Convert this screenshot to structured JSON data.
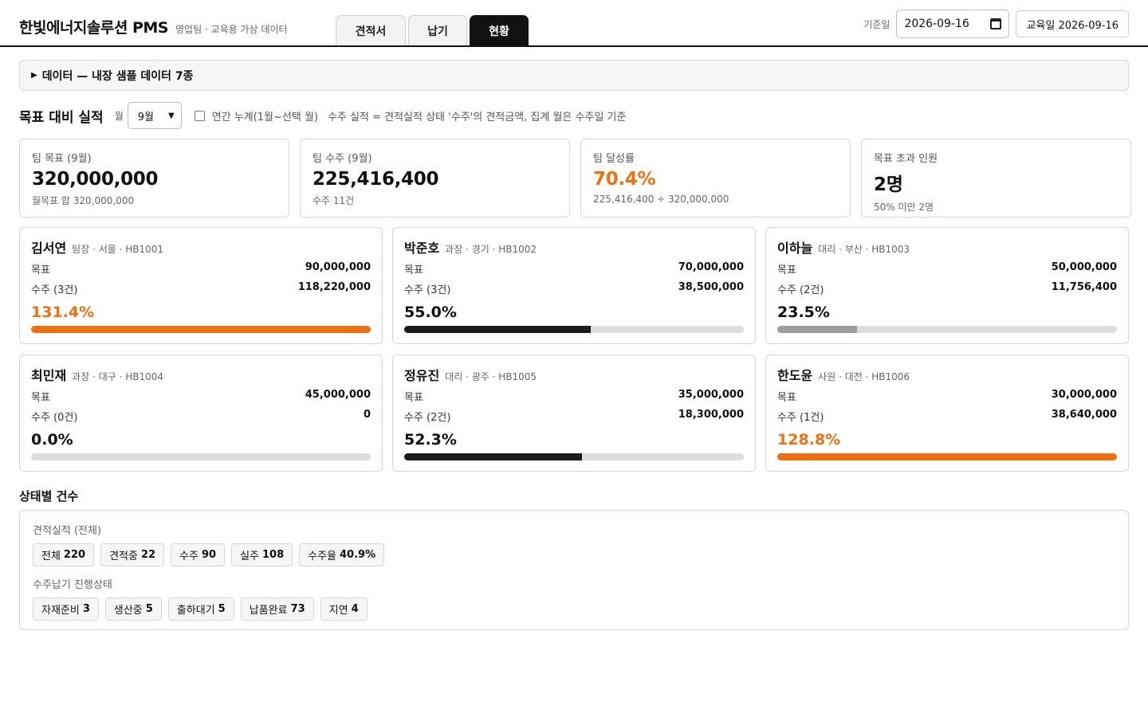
{
  "header": {
    "title": "한빛에너지솔루션 PMS",
    "subtitle": "영업팀 · 교육용 가상 데이터",
    "tabs": [
      {
        "label": "견적서"
      },
      {
        "label": "납기"
      },
      {
        "label": "현황",
        "active": true
      }
    ],
    "base_date_label": "기준일",
    "base_date_value": "2026-09-16",
    "edu_button": "교육일 2026-09-16"
  },
  "data_panel": {
    "label": "데이터 — 내장 샘플 데이터 7종"
  },
  "target_section": {
    "title": "목표 대비 실적",
    "month_label": "월",
    "month_value": "9월",
    "cumulative_label": "연간 누계(1월~선택 월)",
    "note": "수주 실적 = 견적실적 상태 '수주'의 견적금액, 집계 월은 수주일 기준"
  },
  "kpis": [
    {
      "label": "팀 목표 (9월)",
      "value": "320,000,000",
      "sub": "월목표 합 320,000,000",
      "accent": false
    },
    {
      "label": "팀 수주 (9월)",
      "value": "225,416,400",
      "sub": "수주 11건",
      "accent": false
    },
    {
      "label": "팀 달성률",
      "value": "70.4%",
      "sub": "225,416,400 ÷ 320,000,000",
      "accent": true
    },
    {
      "label": "목표 초과 인원",
      "value": "2명",
      "sub": "50% 미만 2명",
      "accent": false
    }
  ],
  "people": [
    {
      "name": "김서연",
      "meta": "팀장 · 서울 · HB1001",
      "target_label": "목표",
      "target": "90,000,000",
      "order_label": "수주 (3건)",
      "order": "118,220,000",
      "rate": "131.4%",
      "progress": 1.0,
      "color": "#f07010",
      "rate_accent": true
    },
    {
      "name": "박준호",
      "meta": "과장 · 경기 · HB1002",
      "target_label": "목표",
      "target": "70,000,000",
      "order_label": "수주 (3건)",
      "order": "38,500,000",
      "rate": "55.0%",
      "progress": 0.55,
      "color": "#1b1b1b",
      "rate_accent": false
    },
    {
      "name": "이하늘",
      "meta": "대리 · 부산 · HB1003",
      "target_label": "목표",
      "target": "50,000,000",
      "order_label": "수주 (2건)",
      "order": "11,756,400",
      "rate": "23.5%",
      "progress": 0.235,
      "color": "#9e9e9e",
      "rate_accent": false
    },
    {
      "name": "최민재",
      "meta": "과장 · 대구 · HB1004",
      "target_label": "목표",
      "target": "45,000,000",
      "order_label": "수주 (0건)",
      "order": "0",
      "rate": "0.0%",
      "progress": 0.0,
      "color": "#9e9e9e",
      "rate_accent": false
    },
    {
      "name": "정유진",
      "meta": "대리 · 광주 · HB1005",
      "target_label": "목표",
      "target": "35,000,000",
      "order_label": "수주 (2건)",
      "order": "18,300,000",
      "rate": "52.3%",
      "progress": 0.523,
      "color": "#1b1b1b",
      "rate_accent": false
    },
    {
      "name": "한도윤",
      "meta": "사원 · 대전 · HB1006",
      "target_label": "목표",
      "target": "30,000,000",
      "order_label": "수주 (1건)",
      "order": "38,640,000",
      "rate": "128.8%",
      "progress": 1.0,
      "color": "#f07010",
      "rate_accent": true
    }
  ],
  "status": {
    "title": "상태별 건수",
    "groups": [
      {
        "label": "견적실적 (전체)",
        "chips": [
          {
            "label": "전체",
            "count": "220"
          },
          {
            "label": "견적중",
            "count": "22"
          },
          {
            "label": "수주",
            "count": "90"
          },
          {
            "label": "실주",
            "count": "108"
          },
          {
            "label": "수주율",
            "count": "40.9%"
          }
        ]
      },
      {
        "label": "수주납기 진행상태",
        "chips": [
          {
            "label": "자재준비",
            "count": "3"
          },
          {
            "label": "생산중",
            "count": "5"
          },
          {
            "label": "출하대기",
            "count": "5"
          },
          {
            "label": "납품완료",
            "count": "73"
          },
          {
            "label": "지연",
            "count": "4"
          }
        ]
      }
    ]
  }
}
